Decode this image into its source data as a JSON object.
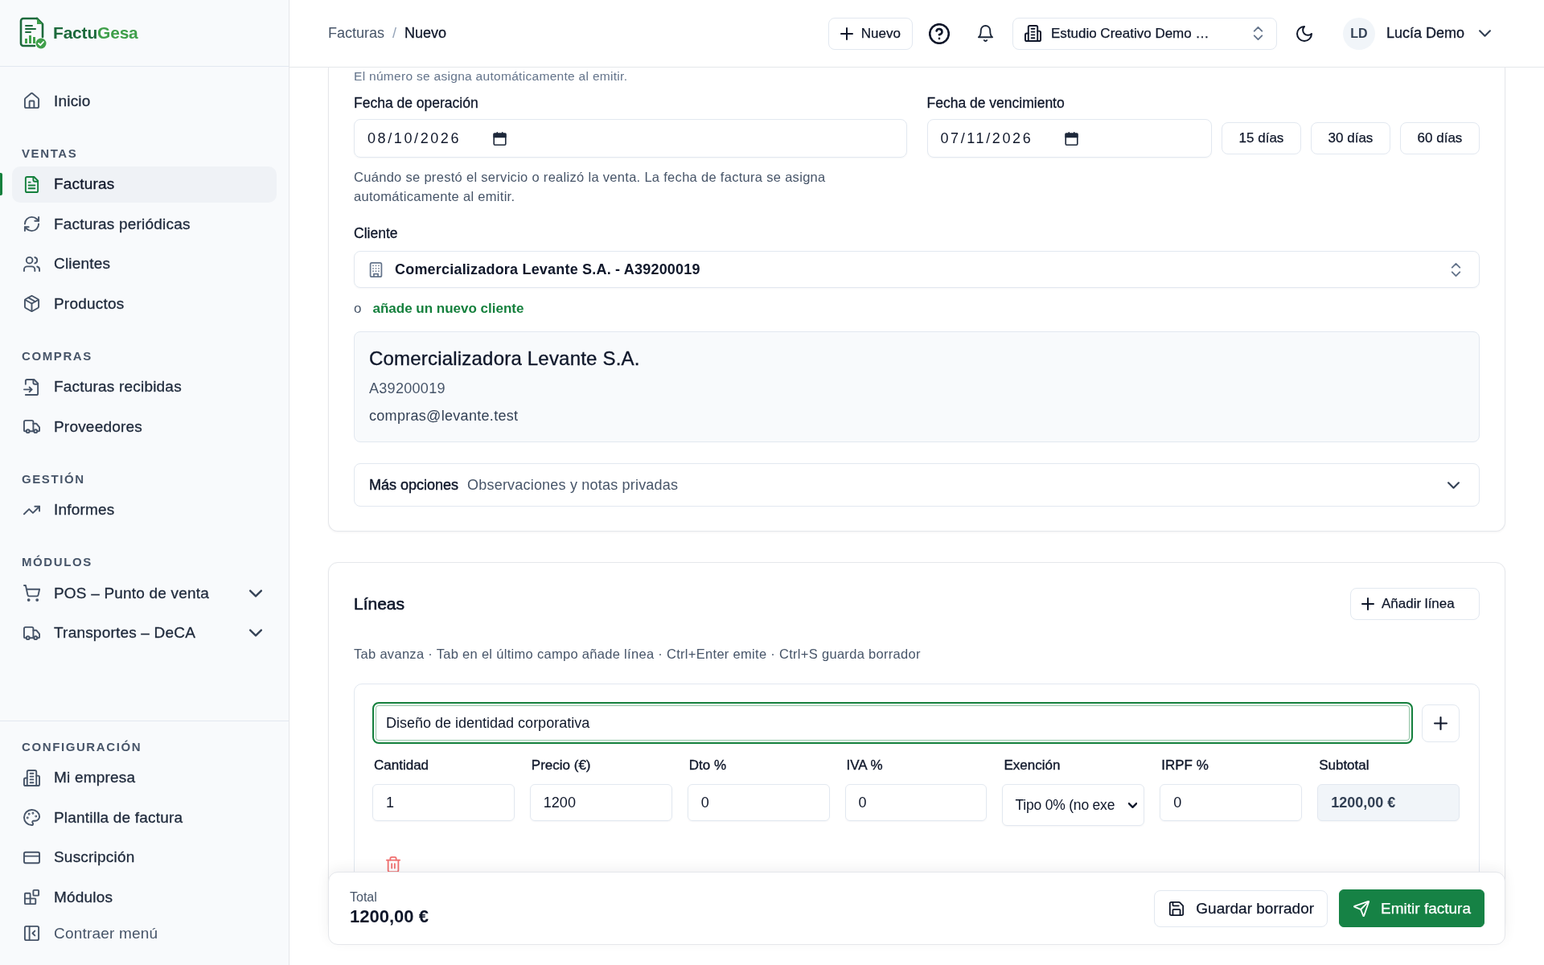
{
  "sidebar": {
    "brand": [
      "Factu",
      "Gesa"
    ],
    "sections": [
      {
        "items": [
          {
            "label": "Inicio",
            "selected": false
          }
        ]
      },
      {
        "heading": "VENTAS",
        "items": [
          {
            "label": "Facturas",
            "selected": true
          },
          {
            "label": "Facturas periódicas",
            "selected": false
          },
          {
            "label": "Clientes",
            "selected": false
          },
          {
            "label": "Productos",
            "selected": false
          }
        ]
      },
      {
        "heading": "COMPRAS",
        "items": [
          {
            "label": "Facturas recibidas",
            "selected": false
          },
          {
            "label": "Proveedores",
            "selected": false
          }
        ]
      },
      {
        "heading": "GESTIÓN",
        "items": [
          {
            "label": "Informes",
            "selected": false
          }
        ]
      },
      {
        "heading": "MÓDULOS",
        "items": [
          {
            "label": "POS – Punto de venta",
            "selected": false,
            "expanded": false
          },
          {
            "label": "Transportes – DeCA",
            "selected": false,
            "expanded": false
          }
        ]
      }
    ],
    "settings": {
      "heading": "CONFIGURACIÓN",
      "items": [
        {
          "label": "Mi empresa",
          "selected": false
        },
        {
          "label": "Plantilla de factura",
          "selected": false
        },
        {
          "label": "Suscripción",
          "selected": false
        },
        {
          "label": "Módulos",
          "selected": false
        }
      ]
    },
    "collapse": "Contraer menú"
  },
  "topbar": {
    "breadcrumbs": [
      "Facturas",
      "Nuevo"
    ],
    "separator": "/",
    "new_button": "Nuevo",
    "company": "Estudio Creativo Demo …",
    "user": {
      "initials": "LD",
      "name": "Lucía Demo"
    }
  },
  "invoice": {
    "note": "El número se asigna automáticamente al emitir.",
    "operation_date": {
      "label": "Fecha de operación",
      "value": "08/10/2026"
    },
    "due_date": {
      "label": "Fecha de vencimiento",
      "value": "07/11/2026",
      "presets": [
        "15 días",
        "30 días",
        "60 días"
      ]
    },
    "date_hint": "Cuándo se prestó el servicio o realizó la venta. La fecha de factura se asigna automáticamente al emitir.",
    "client": {
      "label": "Cliente",
      "value": "Comercializadora Levante S.A. - A39200019",
      "alt_prefix": "o",
      "alt_link": "añade un nuevo cliente",
      "card": {
        "name": "Comercializadora Levante S.A.",
        "tax_id": "A39200019",
        "email": "compras@levante.test"
      }
    },
    "more_options": {
      "title": "Más opciones",
      "subtitle": "Observaciones y notas privadas",
      "expanded": false
    }
  },
  "lines": {
    "title": "Líneas",
    "add_button": "Añadir línea",
    "hint": "Tab avanza · Tab en el último campo añade línea · Ctrl+Enter emite · Ctrl+S guarda borrador",
    "items": [
      {
        "description": "Diseño de identidad corporativa",
        "focused": true,
        "fields": [
          {
            "kind": "input",
            "label": "Cantidad",
            "value": "1"
          },
          {
            "kind": "input",
            "label": "Precio (€)",
            "value": "1200"
          },
          {
            "kind": "input",
            "label": "Dto %",
            "value": "0"
          },
          {
            "kind": "input",
            "label": "IVA %",
            "value": "0"
          },
          {
            "kind": "select",
            "label": "Exención",
            "value": "Tipo 0% (no exe"
          },
          {
            "kind": "input",
            "label": "IRPF %",
            "value": "0"
          },
          {
            "kind": "readonly",
            "label": "Subtotal",
            "value": "1200,00 €"
          }
        ]
      }
    ]
  },
  "footer": {
    "total_label": "Total",
    "total": "1200,00 €",
    "save_button": "Guardar borrador",
    "issue_button": "Emitir factura"
  }
}
